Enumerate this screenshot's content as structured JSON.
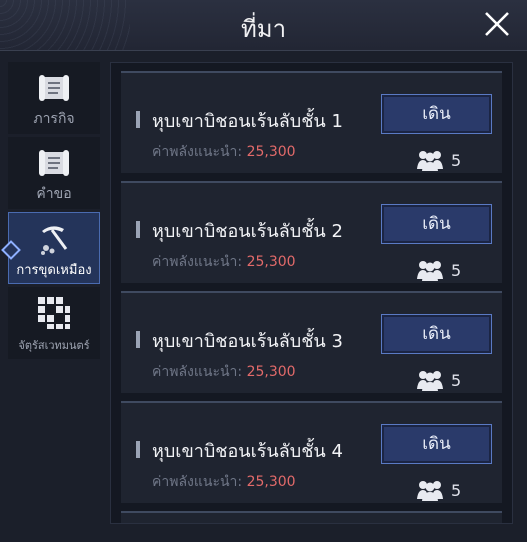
{
  "header": {
    "title": "ที่มา"
  },
  "sidebar": {
    "items": [
      {
        "label": "ภารกิจ",
        "icon": "scroll-icon"
      },
      {
        "label": "คำขอ",
        "icon": "scroll-icon"
      },
      {
        "label": "การขุดเหมือง",
        "icon": "pickaxe-icon"
      },
      {
        "label": "จัตุรัสเวทมนตร์",
        "icon": "grid-icon"
      }
    ]
  },
  "list": {
    "cards": [
      {
        "title": "หุบเขาบิชอนเร้นลับชั้น 1",
        "power_label": "ค่าพลังแนะนำ:",
        "power_value": "25,300",
        "button": "เดิน",
        "party_size": "5"
      },
      {
        "title": "หุบเขาบิชอนเร้นลับชั้น 2",
        "power_label": "ค่าพลังแนะนำ:",
        "power_value": "25,300",
        "button": "เดิน",
        "party_size": "5"
      },
      {
        "title": "หุบเขาบิชอนเร้นลับชั้น 3",
        "power_label": "ค่าพลังแนะนำ:",
        "power_value": "25,300",
        "button": "เดิน",
        "party_size": "5"
      },
      {
        "title": "หุบเขาบิชอนเร้นลับชั้น 4",
        "power_label": "ค่าพลังแนะนำ:",
        "power_value": "25,300",
        "button": "เดิน",
        "party_size": "5"
      }
    ]
  },
  "colors": {
    "accent": "#2a3a6a",
    "power": "#e26a6a",
    "active_tab": "#24345a"
  }
}
